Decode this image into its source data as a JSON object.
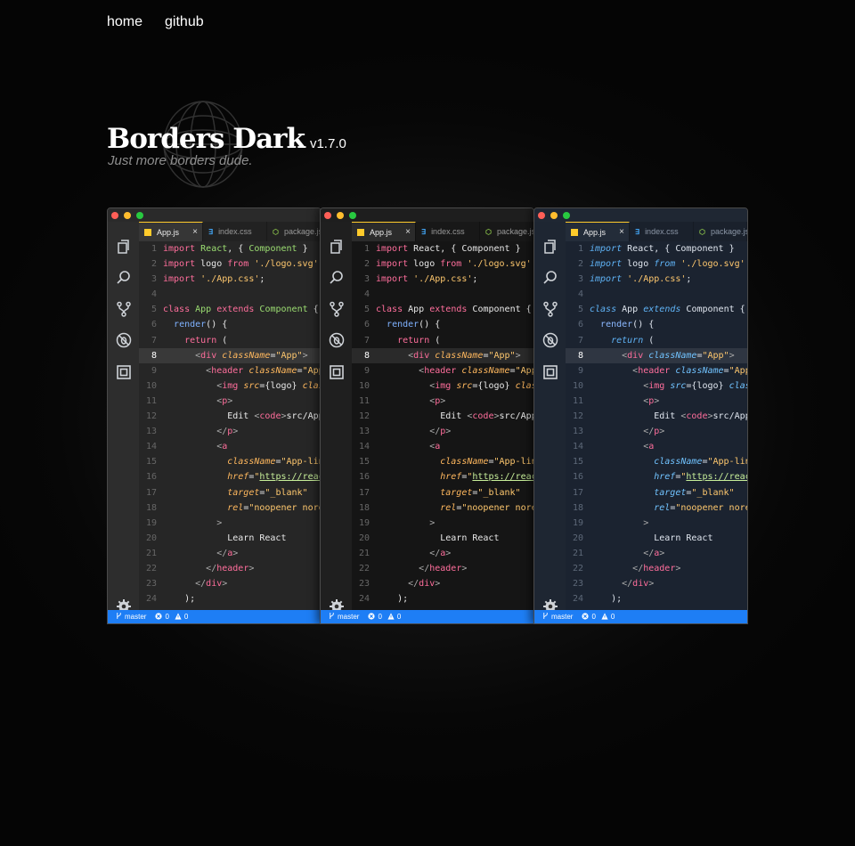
{
  "nav": {
    "home": "home",
    "github": "github"
  },
  "hero": {
    "title": "Borders Dark",
    "version": "v1.7.0",
    "tagline": "Just more borders dude."
  },
  "editors": [
    {
      "theme": "th-a"
    },
    {
      "theme": "th-b"
    },
    {
      "theme": "th-c"
    }
  ],
  "tabs": [
    "App.js",
    "index.css",
    "package.json"
  ],
  "tab_close": "×",
  "status": {
    "branch": "master",
    "errors": "0",
    "warnings": "0"
  },
  "colors": {
    "status_bar": "#1e7ef5",
    "accent_tab": "#ffcb2b",
    "dot_red": "#ff5f57",
    "dot_yellow": "#ffbd2e",
    "dot_green": "#28c940"
  },
  "icons": {
    "activity": [
      "files-icon",
      "search-icon",
      "source-control-icon",
      "debug-icon",
      "extensions-icon"
    ],
    "settings": "gear-icon"
  },
  "active_line": 8,
  "code_lines": [
    [
      [
        "kw",
        "import"
      ],
      [
        "pl",
        " "
      ],
      [
        "cls",
        "React"
      ],
      [
        "pl",
        ", { "
      ],
      [
        "cls",
        "Component"
      ],
      [
        "pl",
        " }"
      ]
    ],
    [
      [
        "kw",
        "import"
      ],
      [
        "pl",
        " logo "
      ],
      [
        "kw",
        "from"
      ],
      [
        "pl",
        " "
      ],
      [
        "str",
        "'./logo.svg'"
      ]
    ],
    [
      [
        "kw",
        "import"
      ],
      [
        "pl",
        " "
      ],
      [
        "str",
        "'./App.css'"
      ],
      [
        "pl",
        ";"
      ]
    ],
    [],
    [
      [
        "kw2",
        "class"
      ],
      [
        "pl",
        " "
      ],
      [
        "cls",
        "App"
      ],
      [
        "pl",
        " "
      ],
      [
        "kw2",
        "extends"
      ],
      [
        "pl",
        " "
      ],
      [
        "cls",
        "Component"
      ],
      [
        "pl",
        " {"
      ]
    ],
    [
      [
        "pl",
        "  "
      ],
      [
        "fn",
        "render"
      ],
      [
        "pl",
        "() {"
      ]
    ],
    [
      [
        "pl",
        "    "
      ],
      [
        "kw",
        "return"
      ],
      [
        "pl",
        " ("
      ]
    ],
    [
      [
        "pl",
        "      "
      ],
      [
        "punc",
        "<"
      ],
      [
        "tag",
        "div"
      ],
      [
        "pl",
        " "
      ],
      [
        "attr",
        "className"
      ],
      [
        "pl",
        "="
      ],
      [
        "str",
        "\"App\""
      ],
      [
        "punc",
        ">"
      ]
    ],
    [
      [
        "pl",
        "        "
      ],
      [
        "punc",
        "<"
      ],
      [
        "tag",
        "header"
      ],
      [
        "pl",
        " "
      ],
      [
        "attr",
        "className"
      ],
      [
        "pl",
        "="
      ],
      [
        "str",
        "\"App-header\""
      ],
      [
        "punc",
        ">"
      ]
    ],
    [
      [
        "pl",
        "          "
      ],
      [
        "punc",
        "<"
      ],
      [
        "tag",
        "img"
      ],
      [
        "pl",
        " "
      ],
      [
        "attr",
        "src"
      ],
      [
        "pl",
        "={logo} "
      ],
      [
        "attr",
        "className"
      ]
    ],
    [
      [
        "pl",
        "          "
      ],
      [
        "punc",
        "<"
      ],
      [
        "tag",
        "p"
      ],
      [
        "punc",
        ">"
      ]
    ],
    [
      [
        "pl",
        "            Edit "
      ],
      [
        "punc",
        "<"
      ],
      [
        "tag",
        "code"
      ],
      [
        "punc",
        ">"
      ],
      [
        "pl",
        "src/App.js"
      ]
    ],
    [
      [
        "pl",
        "          "
      ],
      [
        "punc",
        "</"
      ],
      [
        "tag",
        "p"
      ],
      [
        "punc",
        ">"
      ]
    ],
    [
      [
        "pl",
        "          "
      ],
      [
        "punc",
        "<"
      ],
      [
        "tag",
        "a"
      ]
    ],
    [
      [
        "pl",
        "            "
      ],
      [
        "attr",
        "className"
      ],
      [
        "pl",
        "="
      ],
      [
        "str",
        "\"App-link\""
      ]
    ],
    [
      [
        "pl",
        "            "
      ],
      [
        "attr",
        "href"
      ],
      [
        "pl",
        "="
      ],
      [
        "str",
        "\""
      ],
      [
        "url",
        "https://reactjs.org"
      ]
    ],
    [
      [
        "pl",
        "            "
      ],
      [
        "attr",
        "target"
      ],
      [
        "pl",
        "="
      ],
      [
        "str",
        "\"_blank\""
      ]
    ],
    [
      [
        "pl",
        "            "
      ],
      [
        "attr",
        "rel"
      ],
      [
        "pl",
        "="
      ],
      [
        "str",
        "\"noopener noreferrer\""
      ]
    ],
    [
      [
        "pl",
        "          "
      ],
      [
        "punc",
        ">"
      ]
    ],
    [
      [
        "pl",
        "            Learn React"
      ]
    ],
    [
      [
        "pl",
        "          "
      ],
      [
        "punc",
        "</"
      ],
      [
        "tag",
        "a"
      ],
      [
        "punc",
        ">"
      ]
    ],
    [
      [
        "pl",
        "        "
      ],
      [
        "punc",
        "</"
      ],
      [
        "tag",
        "header"
      ],
      [
        "punc",
        ">"
      ]
    ],
    [
      [
        "pl",
        "      "
      ],
      [
        "punc",
        "</"
      ],
      [
        "tag",
        "div"
      ],
      [
        "punc",
        ">"
      ]
    ],
    [
      [
        "pl",
        "    );"
      ]
    ]
  ]
}
